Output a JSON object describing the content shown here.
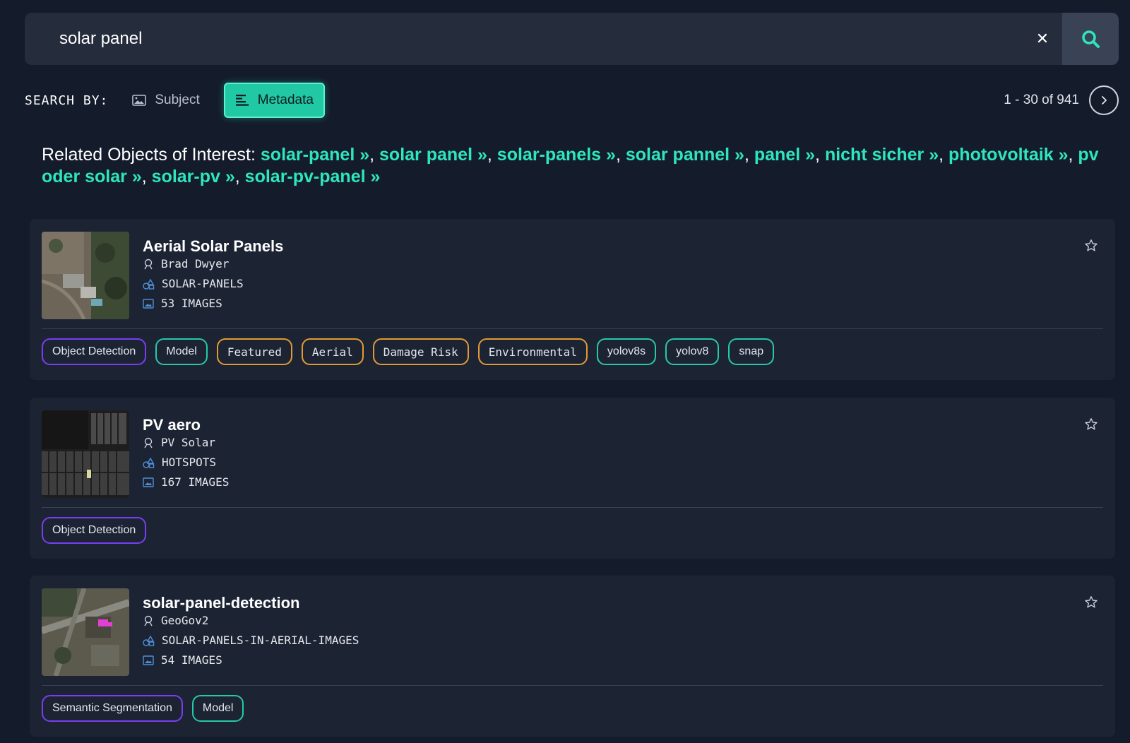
{
  "search": {
    "value": "solar panel",
    "clear_label": "✕"
  },
  "search_by": {
    "label": "SEARCH BY:",
    "subject_label": "Subject",
    "metadata_label": "Metadata"
  },
  "pagination": {
    "text": "1 - 30 of 941"
  },
  "related": {
    "prefix": "Related Objects of Interest:",
    "links": [
      "solar-panel",
      "solar panel",
      "solar-panels",
      "solar pannel",
      "panel",
      "nicht sicher",
      "photovoltaik",
      "pv oder solar",
      "solar-pv",
      "solar-pv-panel"
    ]
  },
  "results": [
    {
      "title": "Aerial Solar Panels",
      "author": "Brad Dwyer",
      "class": "SOLAR-PANELS",
      "images": "53 IMAGES",
      "tags": [
        "Object Detection",
        "Model",
        "Featured",
        "Aerial",
        "Damage Risk",
        "Environmental",
        "yolov8s",
        "yolov8",
        "snap"
      ]
    },
    {
      "title": "PV aero",
      "author": "PV Solar",
      "class": "HOTSPOTS",
      "images": "167 IMAGES",
      "tags": [
        "Object Detection"
      ]
    },
    {
      "title": "solar-panel-detection",
      "author": "GeoGov2",
      "class": "SOLAR-PANELS-IN-AERIAL-IMAGES",
      "images": "54 IMAGES",
      "tags": [
        "Semantic Segmentation",
        "Model"
      ]
    }
  ],
  "colors": {
    "background": "#141b2b",
    "accent": "#2ee6bd",
    "card": "#1c2434",
    "tag_purple": "#7a3df0",
    "tag_teal": "#26c9a6",
    "tag_orange": "#e39a34"
  }
}
